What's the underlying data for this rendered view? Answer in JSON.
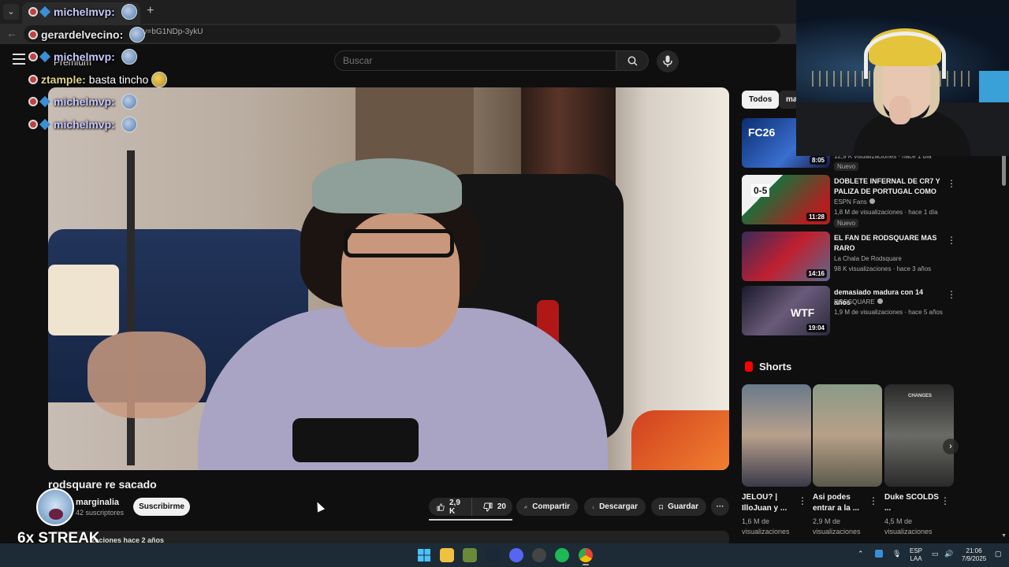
{
  "browser": {
    "url": "?v=bG1NDp-3ykU",
    "new_tab_symbol": "+",
    "back_symbol": "←",
    "dropdown_symbol": "⌄"
  },
  "header": {
    "premium_label": "Premium",
    "search_placeholder": "Buscar"
  },
  "chat": [
    {
      "user": "michelmvp:",
      "message": "",
      "user_color": "#c8c8ff",
      "emote": true
    },
    {
      "user": "gerardelvecino:",
      "message": "",
      "user_color": "#e8e8e8",
      "emote": true
    },
    {
      "user": "michelmvp:",
      "message": "",
      "user_color": "#c8c8ff",
      "emote": true
    },
    {
      "user": "ztample:",
      "message": "basta tincho",
      "user_color": "#dfd38a",
      "emote": true
    },
    {
      "user": "michelmvp:",
      "message": "",
      "user_color": "#c8c8ff",
      "emote": true
    },
    {
      "user": "michelmvp:",
      "message": "",
      "user_color": "#c8c8ff",
      "emote": true
    }
  ],
  "video": {
    "title": "rodsquare re sacado",
    "channel": "marginalia",
    "subscribers": "42 suscriptores",
    "subscribe_label": "Suscribirme",
    "likes": "2,9 K",
    "dislikes": "20",
    "share_label": "Compartir",
    "download_label": "Descargar",
    "save_label": "Guardar",
    "more_label": "···",
    "description_meta": "zaciones  hace 2 años"
  },
  "overlay": {
    "streak": "6x STREAK"
  },
  "sidebar": {
    "chips": [
      "Todos",
      "ma"
    ],
    "recommendations": [
      {
        "title": "",
        "channel": "",
        "meta": "12,9 K visualizaciones · hace 1 día",
        "badge": "Nuevo",
        "duration": "8:05",
        "thumb_text": "FC26"
      },
      {
        "title": "DOBLETE INFERNAL DE CR7 Y PALIZA DE PORTUGAL COMO ...",
        "channel": "ESPN Fans",
        "meta": "1,8 M de visualizaciones · hace 1 día",
        "badge": "Nuevo",
        "duration": "11:28",
        "thumb_text": "0-5"
      },
      {
        "title": "EL FAN DE RODSQUARE MAS RARO",
        "channel": "La Chala De Rodsquare",
        "meta": "98 K visualizaciones · hace 3 años",
        "badge": "",
        "duration": "14:16",
        "thumb_text": ""
      },
      {
        "title": "demasiado madura con 14 años",
        "channel": "RODSQUARE",
        "meta": "1,9 M de visualizaciones · hace 5 años",
        "badge": "",
        "duration": "19:04",
        "thumb_text": "WTF"
      }
    ],
    "shorts_label": "Shorts",
    "shorts": [
      {
        "title": "JELOU? | IlloJuan y ...",
        "views": "1,6 M de visualizaciones"
      },
      {
        "title": "Asi podes entrar a la ...",
        "views": "2,9 M de visualizaciones"
      },
      {
        "title": "Duke SCOLDS ...",
        "views": "4,5 M de visualizaciones"
      }
    ],
    "shorts_thumb_text": "CHANGES",
    "shorts_next": "›"
  },
  "taskbar": {
    "lang_line1": "ESP",
    "lang_line2": "LAA",
    "time": "21:06",
    "date": "7/9/2025"
  },
  "colors": {
    "background": "#0f0f0f",
    "accent_red": "#ff0000",
    "taskbar": "#1c2b36"
  }
}
